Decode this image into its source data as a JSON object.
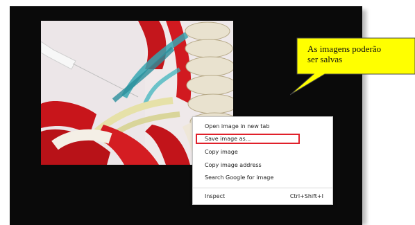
{
  "callout": {
    "line1": "As imagens poderão",
    "line2": "ser salvas",
    "fill": "#ffff00"
  },
  "context_menu": {
    "items": [
      {
        "label": "Open image in new tab"
      },
      {
        "label": "Save image as..."
      },
      {
        "label": "Copy image"
      },
      {
        "label": "Copy image address"
      },
      {
        "label": "Search Google for image"
      },
      {
        "label": "Inspect",
        "shortcut": "Ctrl+Shift+I"
      }
    ],
    "highlight_color": "#e0202a"
  },
  "image": {
    "icon": "anatomical-model-photo"
  }
}
